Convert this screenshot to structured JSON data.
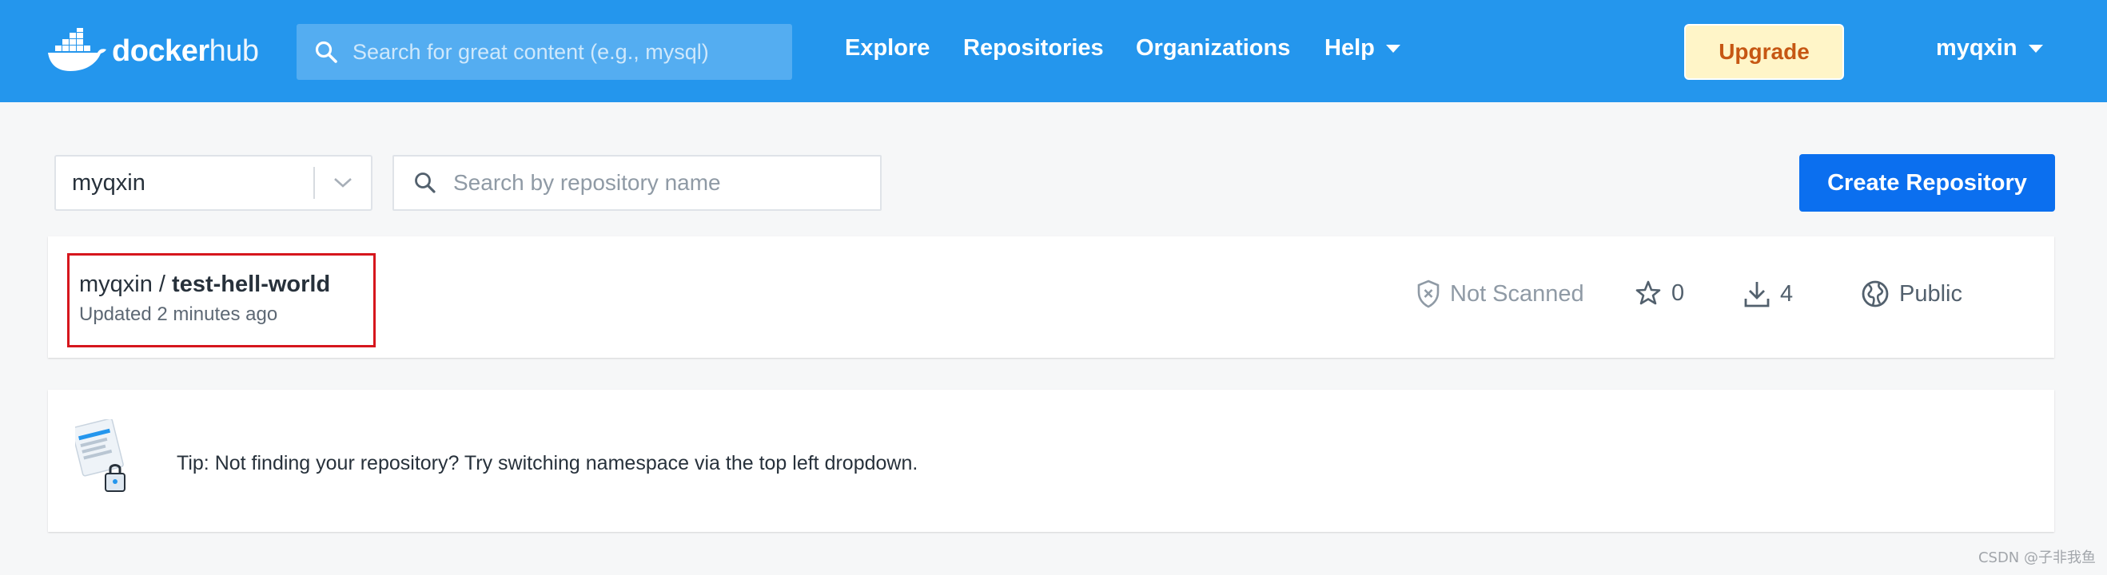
{
  "header": {
    "logo": {
      "word1": "docker",
      "word2": "hub",
      "icon": "docker-whale-icon"
    },
    "search_placeholder": "Search for great content (e.g., mysql)",
    "nav": [
      "Explore",
      "Repositories",
      "Organizations",
      "Help"
    ],
    "upgrade_label": "Upgrade",
    "user_name": "myqxin",
    "colors": {
      "bar": "#2496ed",
      "upgrade_bg": "#fff5c8",
      "upgrade_text": "#c65713"
    }
  },
  "toolbar": {
    "namespace_value": "myqxin",
    "repo_search_placeholder": "Search by repository name",
    "create_label": "Create Repository",
    "create_color": "#0b6fef"
  },
  "repository": {
    "namespace": "myqxin",
    "separator": " / ",
    "name": "test-hell-world",
    "updated": "Updated 2 minutes ago",
    "scan_status": "Not Scanned",
    "stars": "0",
    "pulls": "4",
    "visibility": "Public",
    "highlight_color": "#d6161d"
  },
  "tip": {
    "text": "Tip: Not finding your repository? Try switching namespace via the top left dropdown."
  },
  "watermark": "CSDN @子非我鱼"
}
